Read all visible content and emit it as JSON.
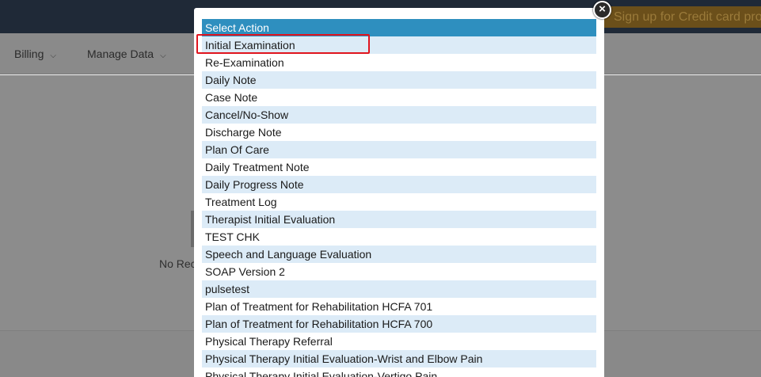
{
  "background": {
    "promo_text": "Sign up for Credit card proc",
    "menu": [
      {
        "label": "Billing"
      },
      {
        "label": "Manage Data"
      }
    ],
    "no_records_text": "No Rec"
  },
  "modal": {
    "header": "Select Action",
    "close_label": "×",
    "items": [
      {
        "label": "Initial Examination"
      },
      {
        "label": "Re-Examination"
      },
      {
        "label": "Daily Note"
      },
      {
        "label": "Case Note"
      },
      {
        "label": "Cancel/No-Show"
      },
      {
        "label": "Discharge Note"
      },
      {
        "label": "Plan Of Care"
      },
      {
        "label": "Daily Treatment Note"
      },
      {
        "label": "Daily Progress Note"
      },
      {
        "label": "Treatment Log"
      },
      {
        "label": "Therapist Initial Evaluation"
      },
      {
        "label": "TEST CHK"
      },
      {
        "label": "Speech and Language Evaluation"
      },
      {
        "label": "SOAP Version 2"
      },
      {
        "label": "pulsetest"
      },
      {
        "label": "Plan of Treatment for Rehabilitation HCFA 701"
      },
      {
        "label": "Plan of Treatment for Rehabilitation HCFA 700"
      },
      {
        "label": "Physical Therapy Referral"
      },
      {
        "label": "Physical Therapy Initial Evaluation-Wrist and Elbow Pain"
      },
      {
        "label": "Physical Therapy Initial Evaluation-Vertigo Pain"
      }
    ]
  },
  "colors": {
    "header_bg": "#2e8fbf",
    "row_alt_bg": "#dcebf7",
    "highlight_border": "#e0141e"
  }
}
